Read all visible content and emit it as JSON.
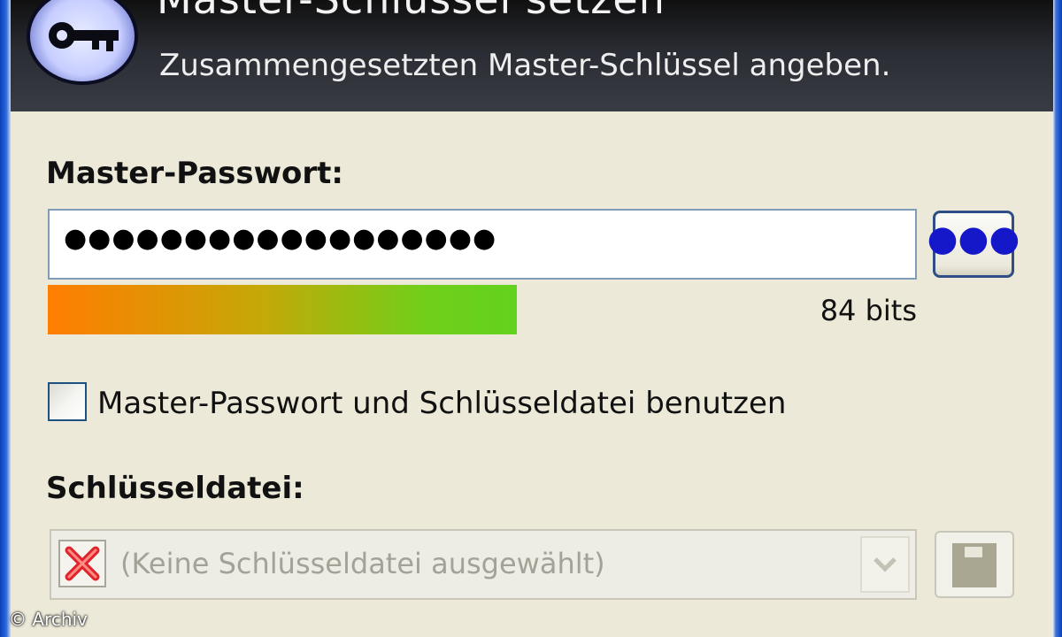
{
  "banner": {
    "title": "Master-Schlüssel setzen",
    "subtitle": "Zusammengesetzten Master-Schlüssel angeben."
  },
  "password": {
    "label": "Master-Passwort:",
    "masked_value": "●●●●●●●●●●●●●●●●●●",
    "reveal_button_label": "●●●",
    "quality_bits": "84 bits",
    "quality_fraction": 0.54
  },
  "options": {
    "use_keyfile_label": "Master-Passwort und Schlüsseldatei benutzen",
    "use_keyfile_checked": false
  },
  "keyfile": {
    "label": "Schlüsseldatei:",
    "selected_value": "(Keine Schlüsseldatei ausgewählt)"
  },
  "watermark": "© Archiv",
  "icons": {
    "banner": "key-icon",
    "keyfile_clear": "red-x-icon",
    "keyfile_open": "disk-icon",
    "combo_arrow": "chevron-down-icon"
  },
  "colors": {
    "banner_bg": "#2a2c33",
    "quality_start": "#ff7d00",
    "quality_end": "#62d21e",
    "reveal_dots": "#1418c8"
  }
}
